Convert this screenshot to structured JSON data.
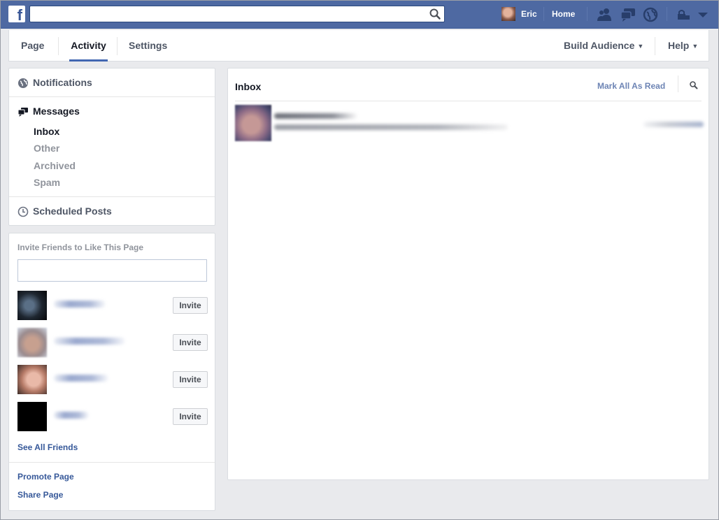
{
  "topbar": {
    "logo": "f",
    "search": {
      "value": "",
      "placeholder": ""
    },
    "user": {
      "name": "Eric"
    },
    "home_label": "Home",
    "icons": [
      "friend-requests-icon",
      "messages-icon",
      "notifications-globe-icon",
      "privacy-shortcuts-icon",
      "account-menu-chevron-icon"
    ]
  },
  "tabs": {
    "left": [
      {
        "label": "Page"
      },
      {
        "label": "Activity",
        "active": true
      },
      {
        "label": "Settings"
      }
    ],
    "build_audience": "Build Audience",
    "help": "Help"
  },
  "leftnav": {
    "notifications": "Notifications",
    "messages": "Messages",
    "message_items": [
      {
        "label": "Inbox",
        "active": true
      },
      {
        "label": "Other"
      },
      {
        "label": "Archived"
      },
      {
        "label": "Spam"
      }
    ],
    "scheduled": "Scheduled Posts"
  },
  "invite": {
    "title": "Invite Friends to Like This Page",
    "search_value": "",
    "friends": [
      {
        "invite_label": "Invite"
      },
      {
        "invite_label": "Invite"
      },
      {
        "invite_label": "Invite"
      },
      {
        "invite_label": "Invite"
      }
    ],
    "see_all": "See All Friends",
    "promote": "Promote Page",
    "share": "Share Page"
  },
  "inbox": {
    "title": "Inbox",
    "mark_all_read": "Mark All As Read",
    "search_icon": "search-icon"
  },
  "colors": {
    "topbar": "#4e69a2",
    "link": "#365899",
    "tab_underline": "#4267b2",
    "page_bg": "#e9eaed"
  }
}
